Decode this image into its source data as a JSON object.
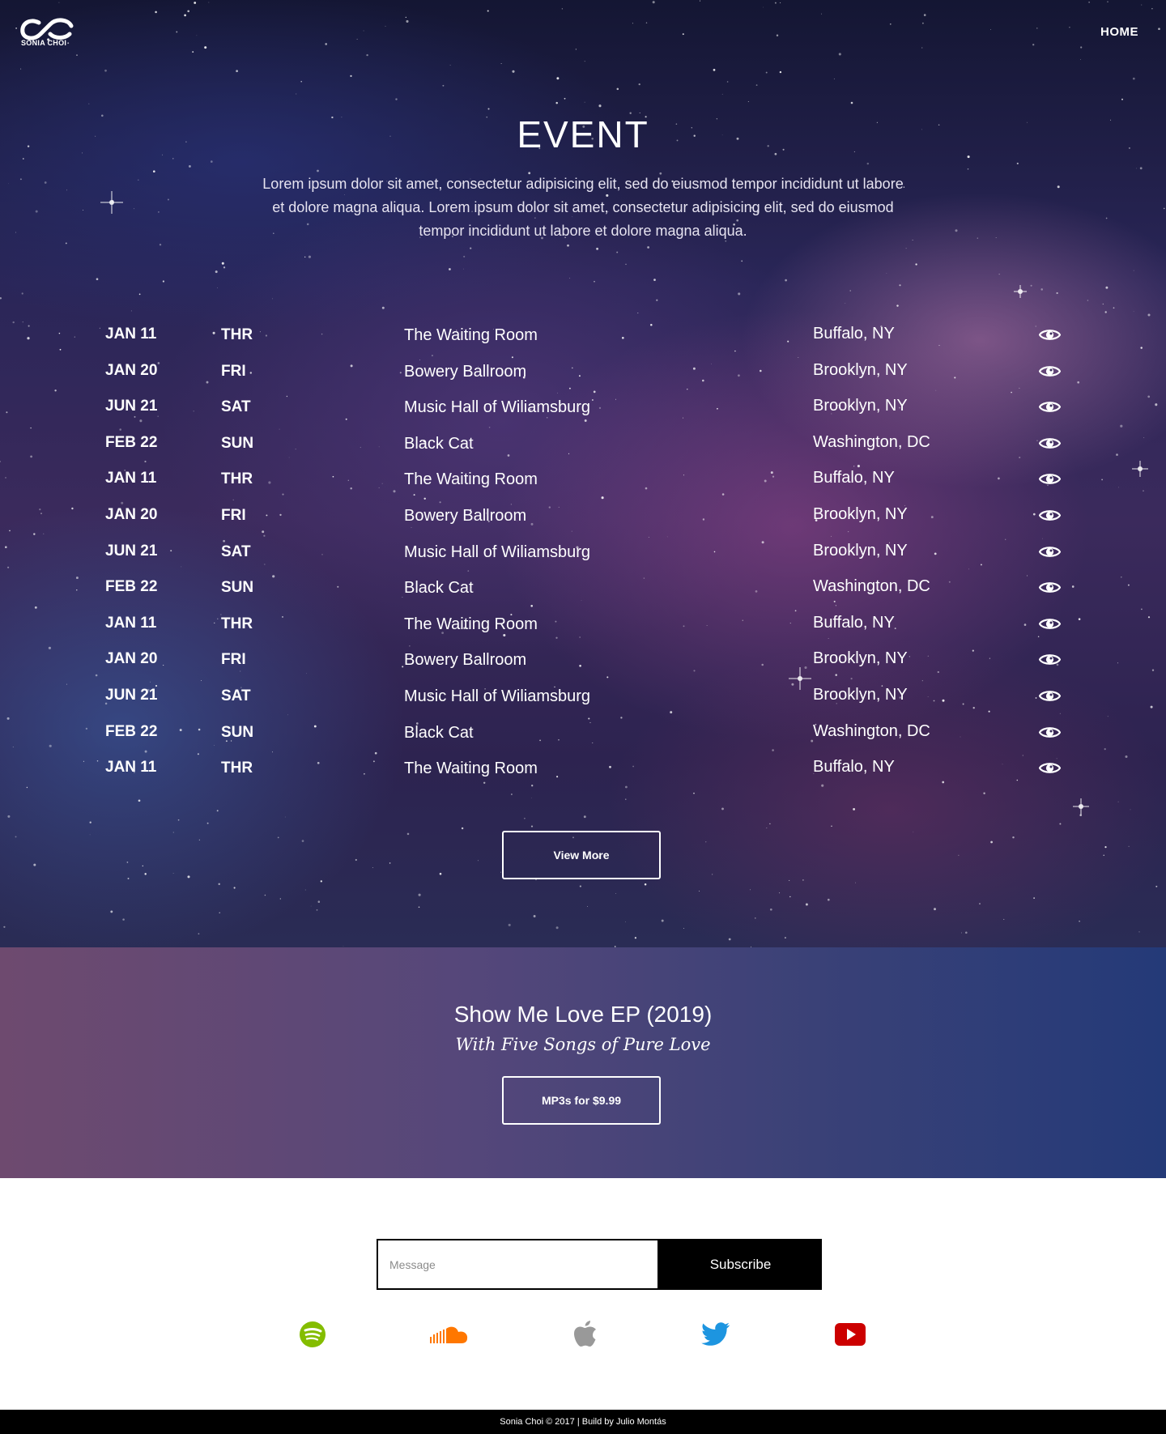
{
  "header": {
    "logo_text": "SONIA CHOI",
    "nav_home": "HOME"
  },
  "event_section": {
    "title": "EVENT",
    "description": "Lorem ipsum dolor sit amet, consectetur adipisicing elit, sed do eiusmod tempor incididunt ut labore et dolore magna aliqua. Lorem ipsum dolor sit amet, consectetur adipisicing elit, sed do eiusmod tempor incididunt ut labore et dolore magna aliqua.",
    "events": [
      {
        "date": "JAN 11",
        "day": "THR",
        "venue": "The Waiting Room",
        "city": "Buffalo, NY"
      },
      {
        "date": "JAN 20",
        "day": "FRI",
        "venue": "Bowery Ballroom",
        "city": "Brooklyn, NY"
      },
      {
        "date": "JUN 21",
        "day": "SAT",
        "venue": "Music Hall of Wiliamsburg",
        "city": "Brooklyn, NY"
      },
      {
        "date": "FEB 22",
        "day": "SUN",
        "venue": "Black Cat",
        "city": "Washington, DC"
      },
      {
        "date": "JAN 11",
        "day": "THR",
        "venue": "The Waiting Room",
        "city": "Buffalo, NY"
      },
      {
        "date": "JAN 20",
        "day": "FRI",
        "venue": "Bowery Ballroom",
        "city": "Brooklyn, NY"
      },
      {
        "date": "JUN 21",
        "day": "SAT",
        "venue": "Music Hall of Wiliamsburg",
        "city": "Brooklyn, NY"
      },
      {
        "date": "FEB 22",
        "day": "SUN",
        "venue": "Black Cat",
        "city": "Washington, DC"
      },
      {
        "date": "JAN 11",
        "day": "THR",
        "venue": "The Waiting Room",
        "city": "Buffalo, NY"
      },
      {
        "date": "JAN 20",
        "day": "FRI",
        "venue": "Bowery Ballroom",
        "city": "Brooklyn, NY"
      },
      {
        "date": "JUN 21",
        "day": "SAT",
        "venue": "Music Hall of Wiliamsburg",
        "city": "Brooklyn, NY"
      },
      {
        "date": "FEB 22",
        "day": "SUN",
        "venue": "Black Cat",
        "city": "Washington, DC"
      },
      {
        "date": "JAN 11",
        "day": "THR",
        "venue": "The Waiting Room",
        "city": "Buffalo, NY"
      }
    ],
    "view_more_label": "View More",
    "row_icon": "eye-icon"
  },
  "ep_section": {
    "title": "Show Me Love EP (2019)",
    "subtitle": "With Five Songs of Pure Love",
    "button_label": "MP3s for $9.99",
    "gradient_start": "#6e4a6f",
    "gradient_end": "#243a78"
  },
  "subscribe": {
    "placeholder": "Message",
    "value": "",
    "button_label": "Subscribe"
  },
  "social_links": [
    {
      "icon": "spotify-icon",
      "color": "#84bd00"
    },
    {
      "icon": "soundcloud-icon",
      "color": "#ff7700"
    },
    {
      "icon": "apple-icon",
      "color": "#999999"
    },
    {
      "icon": "twitter-icon",
      "color": "#1d95e0"
    },
    {
      "icon": "youtube-icon",
      "color": "#cc0000"
    }
  ],
  "footer": {
    "text": "Sonia Choi © 2017 | Build by Julio Montás"
  }
}
